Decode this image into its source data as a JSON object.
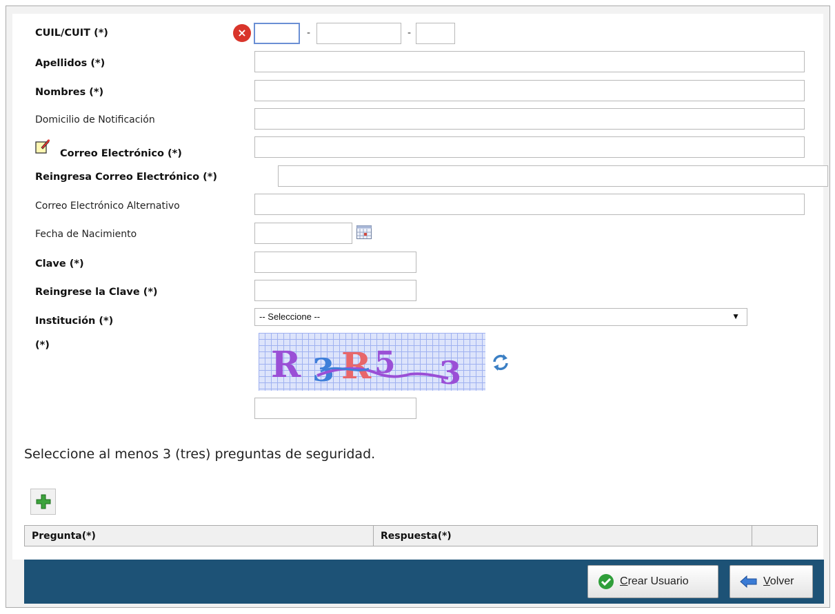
{
  "form": {
    "cuil_label": "CUIL/CUIT (*)",
    "apellidos_label": "Apellidos (*)",
    "nombres_label": "Nombres (*)",
    "domicilio_label": "Domicilio de Notificación",
    "correo_label": "Correo Electrónico (*)",
    "reingresa_correo_label": "Reingresa Correo Electrónico (*)",
    "correo_alt_label": "Correo Electrónico Alternativo",
    "fecha_label": "Fecha de Nacimiento",
    "clave_label": "Clave (*)",
    "reingrese_clave_label": "Reingrese la Clave (*)",
    "institucion_label": "Institución (*)",
    "captcha_label": "(*)",
    "cuil_separator": "-",
    "institucion_selected": "-- Seleccione --"
  },
  "captcha": {
    "text": "R3R5 3"
  },
  "security": {
    "instruction": "Seleccione al menos 3 (tres) preguntas de seguridad.",
    "columns": [
      "Pregunta(*)",
      "Respuesta(*)",
      ""
    ]
  },
  "footer": {
    "crear_first": "C",
    "crear_rest": "rear Usuario",
    "volver_first": "V",
    "volver_rest": "olver"
  },
  "colors": {
    "footer_bar": "#1d5276",
    "error_icon": "#d9352b",
    "add_icon": "#3ca33c",
    "check_icon": "#2f9e3a",
    "back_arrow": "#3a7bd5"
  },
  "icons": {
    "cuil_error": "error-x-icon",
    "correo": "note-edit-icon",
    "fecha": "calendar-icon",
    "captcha_refresh": "refresh-icon",
    "add_question": "plus-icon",
    "crear": "check-circle-icon",
    "volver": "back-arrow-icon"
  }
}
